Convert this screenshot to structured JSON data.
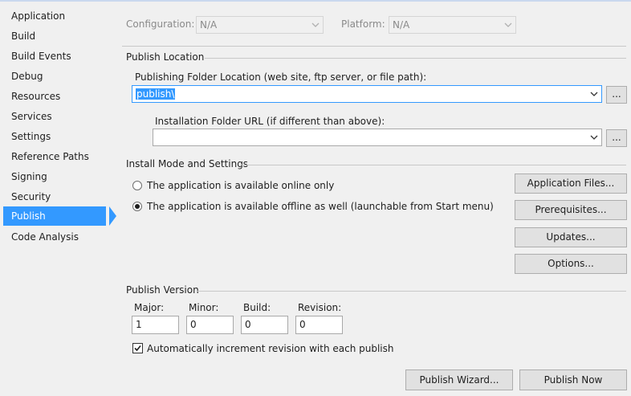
{
  "sidebar": {
    "items": [
      {
        "label": "Application"
      },
      {
        "label": "Build"
      },
      {
        "label": "Build Events"
      },
      {
        "label": "Debug"
      },
      {
        "label": "Resources"
      },
      {
        "label": "Services"
      },
      {
        "label": "Settings"
      },
      {
        "label": "Reference Paths"
      },
      {
        "label": "Signing"
      },
      {
        "label": "Security"
      },
      {
        "label": "Publish"
      },
      {
        "label": "Code Analysis"
      }
    ],
    "active_label": "Publish"
  },
  "header": {
    "configuration_label": "Configuration:",
    "configuration_value": "N/A",
    "platform_label": "Platform:",
    "platform_value": "N/A"
  },
  "publish_location": {
    "title": "Publish Location",
    "folder_label": "Publishing Folder Location (web site, ftp server, or file path):",
    "folder_value": "publish\\",
    "install_label": "Installation Folder URL (if different than above):",
    "install_value": "",
    "browse_label": "..."
  },
  "install_mode": {
    "title": "Install Mode and Settings",
    "option_online": "The application is available online only",
    "option_offline": "The application is available offline as well (launchable from Start menu)",
    "selected": "offline",
    "buttons": {
      "application_files": "Application Files...",
      "prerequisites": "Prerequisites...",
      "updates": "Updates...",
      "options": "Options..."
    }
  },
  "publish_version": {
    "title": "Publish Version",
    "major_label": "Major:",
    "minor_label": "Minor:",
    "build_label": "Build:",
    "revision_label": "Revision:",
    "major": "1",
    "minor": "0",
    "build": "0",
    "revision": "0",
    "auto_increment_label": "Automatically increment revision with each publish",
    "auto_increment_checked": true
  },
  "footer": {
    "publish_wizard": "Publish Wizard...",
    "publish_now": "Publish Now"
  }
}
